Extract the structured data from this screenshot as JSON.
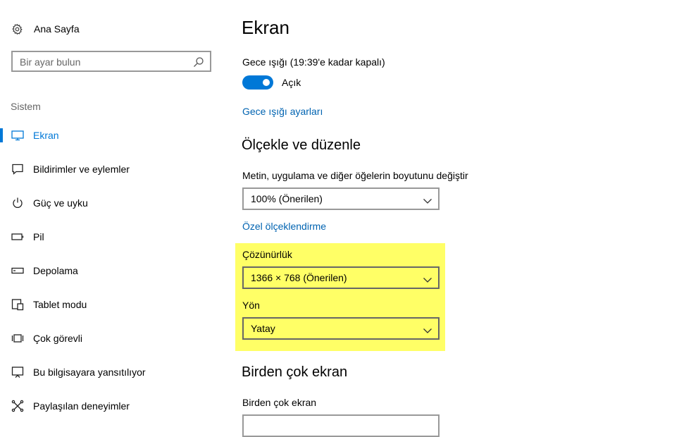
{
  "sidebar": {
    "home_label": "Ana Sayfa",
    "search_placeholder": "Bir ayar bulun",
    "section_title": "Sistem",
    "items": [
      {
        "label": "Ekran",
        "icon": "monitor-icon",
        "active": true
      },
      {
        "label": "Bildirimler ve eylemler",
        "icon": "message-icon"
      },
      {
        "label": "Güç ve uyku",
        "icon": "power-icon"
      },
      {
        "label": "Pil",
        "icon": "battery-icon"
      },
      {
        "label": "Depolama",
        "icon": "storage-icon"
      },
      {
        "label": "Tablet modu",
        "icon": "tablet-icon"
      },
      {
        "label": "Çok görevli",
        "icon": "multitask-icon"
      },
      {
        "label": "Bu bilgisayara yansıtılıyor",
        "icon": "project-icon"
      },
      {
        "label": "Paylaşılan deneyimler",
        "icon": "share-icon"
      }
    ]
  },
  "main": {
    "title": "Ekran",
    "night_light": {
      "label": "Gece ışığı (19:39'e kadar kapalı)",
      "toggle_state": "Açık",
      "settings_link": "Gece ışığı ayarları"
    },
    "scale_section": {
      "heading": "Ölçekle ve düzenle",
      "size_label": "Metin, uygulama ve diğer öğelerin boyutunu değiştir",
      "size_value": "100% (Önerilen)",
      "custom_link": "Özel ölçeklendirme",
      "resolution_label": "Çözünürlük",
      "resolution_value": "1366 × 768 (Önerilen)",
      "orientation_label": "Yön",
      "orientation_value": "Yatay"
    },
    "multi_section": {
      "heading": "Birden çok ekran",
      "label": "Birden çok ekran"
    }
  },
  "colors": {
    "accent": "#0078d7",
    "link": "#0063b1",
    "highlight": "#ffff66"
  }
}
